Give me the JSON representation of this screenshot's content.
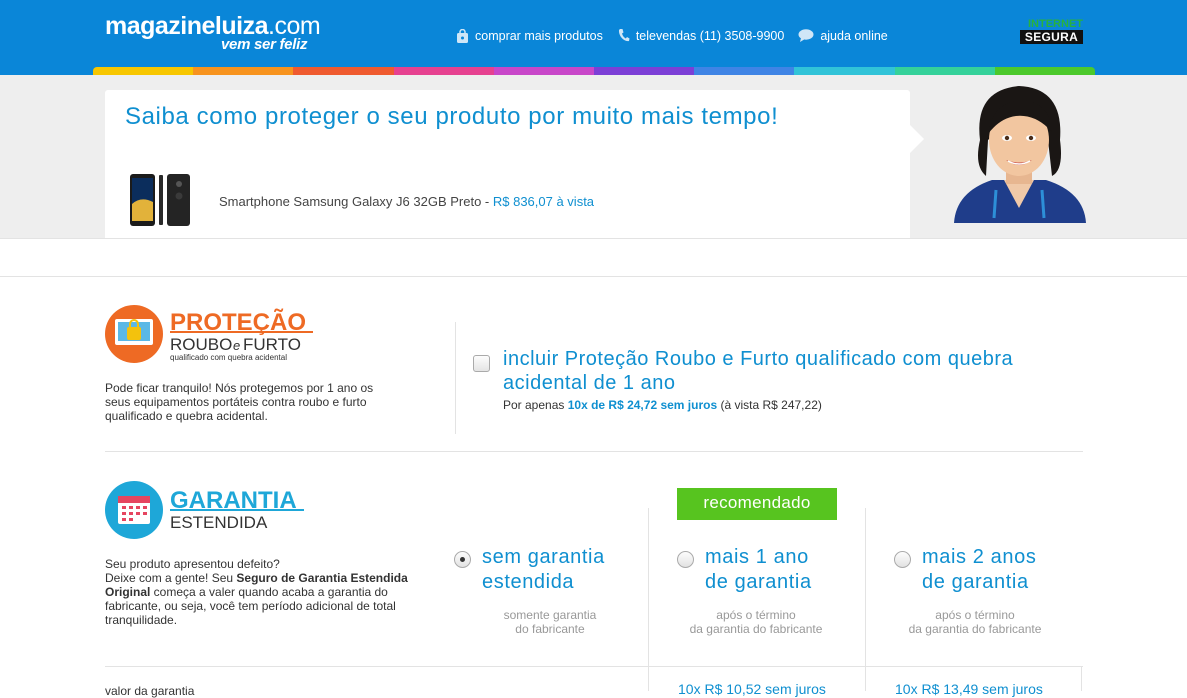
{
  "header": {
    "logo_main": "magazineluiza",
    "logo_dotcom": ".com",
    "logo_slogan": "vem ser feliz",
    "nav": [
      {
        "label": "comprar mais produtos",
        "icon": "bag-icon"
      },
      {
        "label": "televendas (11) 3508-9900",
        "icon": "phone-icon"
      },
      {
        "label": "ajuda online",
        "icon": "chat-bubble-icon"
      }
    ],
    "seal_line1": "INTERNET",
    "seal_line2": "SEGURA"
  },
  "colors": {
    "header_bg": "#0a86d8",
    "accent_blue": "#0f8fd0",
    "recommended_green": "#57c41f",
    "protection_orange": "#ee6a24",
    "warranty_cyan": "#1ea7d8",
    "colorbar": [
      "#f7c600",
      "#f7931e",
      "#ef5a2f",
      "#e64190",
      "#c847c9",
      "#7c3fd6",
      "#3f84e5",
      "#31c3d8",
      "#35d19a",
      "#4cc92c"
    ]
  },
  "banner": {
    "headline": "Saiba como proteger o seu produto por muito mais tempo!",
    "product_name": "Smartphone Samsung Galaxy J6 32GB Preto - ",
    "product_price": "R$ 836,07 à vista"
  },
  "protection": {
    "logo_title": "PROTEÇÃO",
    "logo_sub1": "ROUBO",
    "logo_sub_e": "e",
    "logo_sub2": "FURTO",
    "logo_caption": "qualificado com quebra acidental",
    "description": "Pode ficar tranquilo! Nós protegemos por 1 ano os seus equipamentos portáteis contra roubo e furto qualificado e quebra acidental.",
    "option_title": "incluir Proteção Roubo e Furto qualificado com quebra acidental de 1 ano",
    "option_prefix": "Por apenas ",
    "option_installments": "10x de R$ 24,72 sem juros",
    "option_suffix": " (à vista R$ 247,22)",
    "checked": false
  },
  "warranty": {
    "logo_title": "GARANTIA",
    "logo_sub": "ESTENDIDA",
    "desc_line1": "Seu produto apresentou defeito?",
    "desc_line2_prefix": "Deixe com a gente! Seu ",
    "desc_bold": "Seguro de Garantia Estendida Original",
    "desc_suffix": " começa a valer quando acaba a garantia do fabricante, ou seja, você tem período adicional de total tranquilidade.",
    "recommended_label": "recomendado",
    "options": [
      {
        "title1": "sem garantia",
        "title2": "estendida",
        "sub1": "somente garantia",
        "sub2": "do fabricante",
        "selected": true
      },
      {
        "title1": "mais 1 ano",
        "title2": "de garantia",
        "sub1": "após o término",
        "sub2": "da garantia do fabricante",
        "selected": false
      },
      {
        "title1": "mais 2 anos",
        "title2": "de garantia",
        "sub1": "após o término",
        "sub2": "da garantia do fabricante",
        "selected": false
      }
    ],
    "price_row_label": "valor da garantia",
    "price_row_values": [
      "10x R$ 10,52 sem juros",
      "10x R$ 13,49 sem juros"
    ]
  }
}
